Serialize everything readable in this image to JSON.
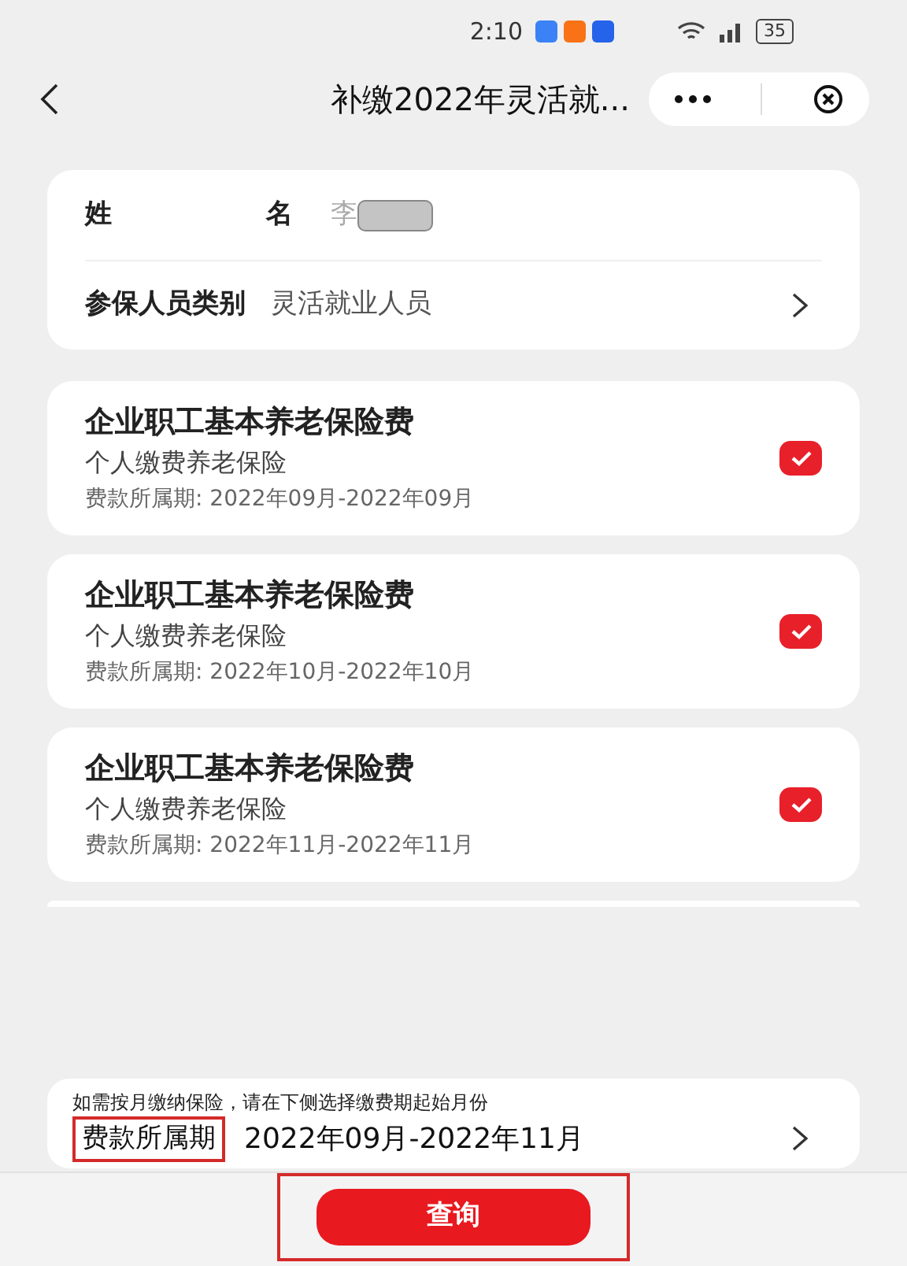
{
  "status_bar": {
    "time": "2:10",
    "battery": "35"
  },
  "nav": {
    "title": "补缴2022年灵活就..."
  },
  "person": {
    "name_label": "姓",
    "name_label_2": "名",
    "name_value": "李",
    "name_redacted": true,
    "category_label": "参保人员类别",
    "category_value": "灵活就业人员"
  },
  "items": [
    {
      "title": "企业职工基本养老保险费",
      "subtitle": "个人缴费养老保险",
      "period": "费款所属期: 2022年09月-2022年09月",
      "checked": true
    },
    {
      "title": "企业职工基本养老保险费",
      "subtitle": "个人缴费养老保险",
      "period": "费款所属期: 2022年10月-2022年10月",
      "checked": true
    },
    {
      "title": "企业职工基本养老保险费",
      "subtitle": "个人缴费养老保险",
      "period": "费款所属期: 2022年11月-2022年11月",
      "checked": true
    }
  ],
  "period_panel": {
    "hint": "如需按月缴纳保险，请在下侧选择缴费期起始月份",
    "label": "费款所属期",
    "label_highlighted": true,
    "value": "2022年09月-2022年11月"
  },
  "query_button": {
    "label": "查询",
    "highlighted": true
  }
}
